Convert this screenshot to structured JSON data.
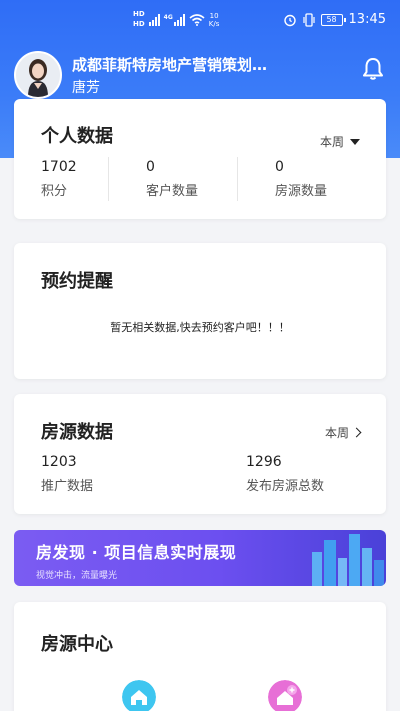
{
  "status_bar": {
    "hd1": "HD",
    "hd2": "HD",
    "net": "4G",
    "speed_value": "10",
    "speed_unit": "K/s",
    "battery": "58",
    "time": "13:45"
  },
  "profile": {
    "company": "成都菲斯特房地产营销策划…",
    "name": "唐芳"
  },
  "personal": {
    "title": "个人数据",
    "period": "本周",
    "stats": [
      {
        "value": "1702",
        "label": "积分"
      },
      {
        "value": "0",
        "label": "客户数量"
      },
      {
        "value": "0",
        "label": "房源数量"
      }
    ]
  },
  "reminder": {
    "title": "预约提醒",
    "empty": "暂无相关数据,快去预约客户吧！！！"
  },
  "listing": {
    "title": "房源数据",
    "period": "本周",
    "stats": [
      {
        "value": "1203",
        "label": "推广数据"
      },
      {
        "value": "1296",
        "label": "发布房源总数"
      }
    ]
  },
  "banner": {
    "title": "房发现 · 项目信息实时展现",
    "subtitle": "视觉冲击，流量曝光"
  },
  "hub": {
    "title": "房源中心"
  },
  "colors": {
    "header_blue": "#2f6df6",
    "banner_purple": "#6c4ff0",
    "icon_teal": "#3ec6f0",
    "icon_pink": "#e76fd6"
  }
}
